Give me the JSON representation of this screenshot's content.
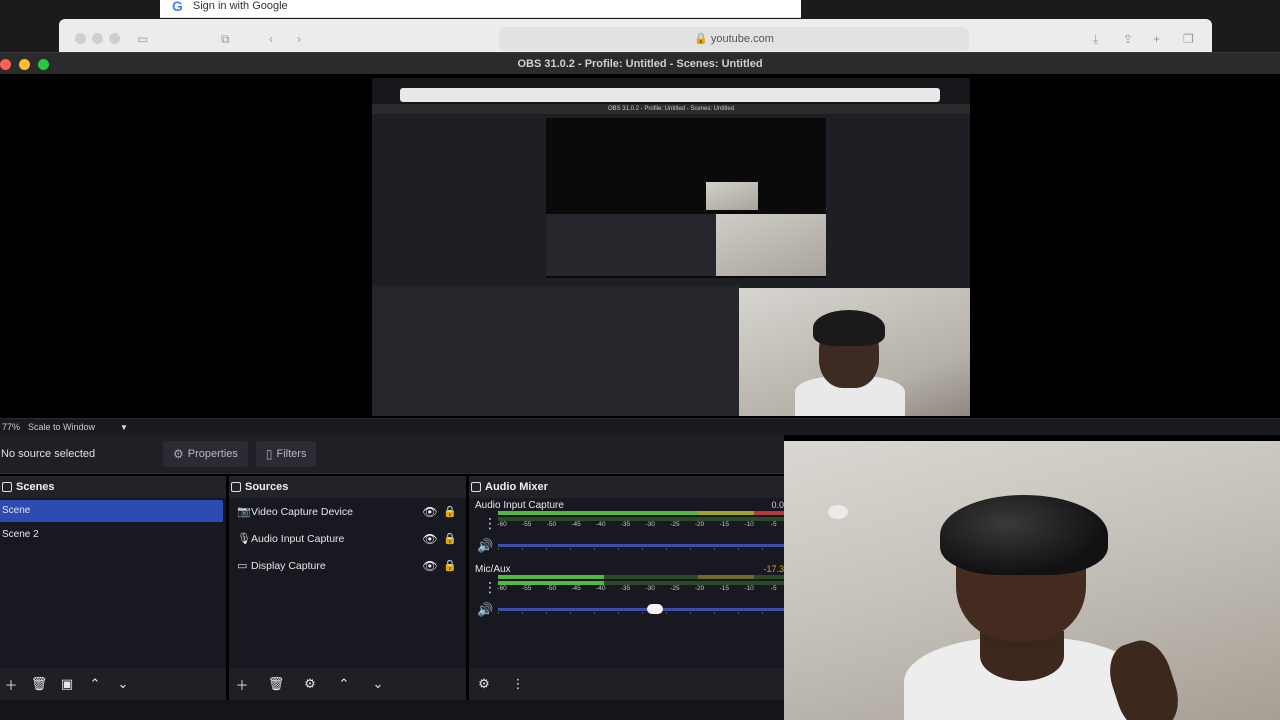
{
  "desktop": {
    "google_banner": "Sign in with Google",
    "url": "youtube.com"
  },
  "obs": {
    "title": "OBS 31.0.2 - Profile: Untitled - Scenes: Untitled",
    "nested_title": "OBS 31.0.2 - Profile: Untitled - Scenes: Untitled",
    "scale": {
      "percent": "77%",
      "mode": "Scale to Window"
    },
    "properties_bar": {
      "no_source": "No source selected",
      "properties_label": "Properties",
      "filters_label": "Filters"
    },
    "scenes": {
      "title": "Scenes",
      "items": [
        {
          "label": "Scene",
          "selected": true
        },
        {
          "label": "Scene 2",
          "selected": false
        }
      ]
    },
    "sources": {
      "title": "Sources",
      "items": [
        {
          "label": "Video Capture Device",
          "icon": "camera-icon"
        },
        {
          "label": "Audio Input Capture",
          "icon": "microphone-icon"
        },
        {
          "label": "Display Capture",
          "icon": "monitor-icon"
        }
      ]
    },
    "mixer": {
      "title": "Audio Mixer",
      "ticks": [
        "-60",
        "-55",
        "-50",
        "-45",
        "-40",
        "-35",
        "-30",
        "-25",
        "-20",
        "-15",
        "-10",
        "-5"
      ],
      "channels": [
        {
          "name": "Audio Input Capture",
          "db": "0.0",
          "db_color": "#d0d0d0",
          "fader_level": 1.0
        },
        {
          "name": "Mic/Aux",
          "db": "-17.3",
          "db_color": "#c8a23a",
          "fader_level": 0.55
        }
      ]
    }
  },
  "colors": {
    "selection": "#2d4bb3",
    "meter_green": "#54b845",
    "meter_yellow": "#a3a32b",
    "meter_red": "#b53b3b"
  }
}
